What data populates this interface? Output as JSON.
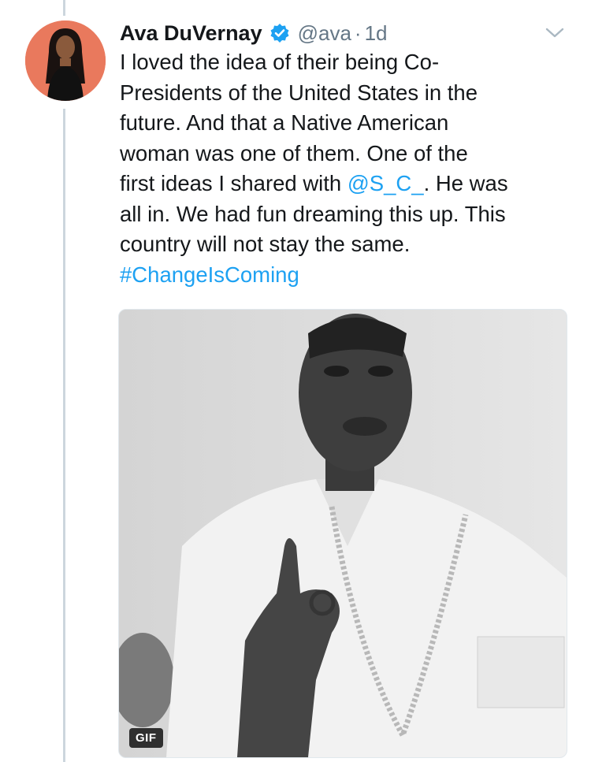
{
  "tweet": {
    "author": {
      "display_name": "Ava DuVernay",
      "handle": "@ava",
      "verified": true,
      "avatar_icon": "avatar-portrait"
    },
    "separator": "·",
    "time": "1d",
    "text_lines": [
      [
        {
          "text": "I loved the idea of their being Co-",
          "type": "text"
        }
      ],
      [
        {
          "text": "Presidents of the United States in the",
          "type": "text"
        }
      ],
      [
        {
          "text": "future. And that a Native American",
          "type": "text"
        }
      ],
      [
        {
          "text": "woman was one of them. One of the",
          "type": "text"
        }
      ],
      [
        {
          "text": "first ideas I shared with ",
          "type": "text"
        },
        {
          "text": "@S_C_",
          "type": "mention"
        },
        {
          "text": ". He was",
          "type": "text"
        }
      ],
      [
        {
          "text": "all in. We had fun dreaming this up. This",
          "type": "text"
        }
      ],
      [
        {
          "text": "country will not stay the same.",
          "type": "text"
        }
      ],
      [
        {
          "text": "#ChangeIsComing",
          "type": "hashtag"
        }
      ]
    ],
    "media": {
      "type": "gif",
      "badge": "GIF"
    }
  },
  "colors": {
    "text": "#14171a",
    "secondary": "#657786",
    "link": "#1da1f2",
    "verified": "#1da1f2",
    "thread_line": "#ccd6dd",
    "avatar_bg": "#e9795d"
  }
}
